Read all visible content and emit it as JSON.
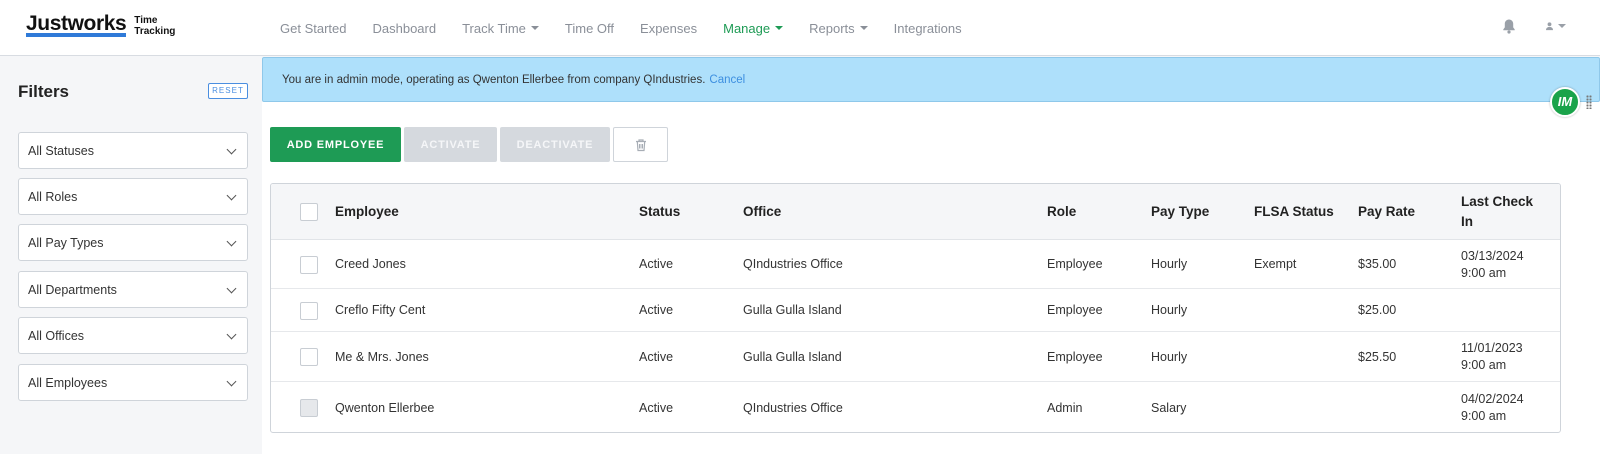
{
  "brand": {
    "name": "Justworks",
    "product_line1": "Time",
    "product_line2": "Tracking",
    "accent": "#2f7ad8"
  },
  "nav": [
    {
      "label": "Get Started",
      "dropdown": false,
      "active": false
    },
    {
      "label": "Dashboard",
      "dropdown": false,
      "active": false
    },
    {
      "label": "Track Time",
      "dropdown": true,
      "active": false
    },
    {
      "label": "Time Off",
      "dropdown": false,
      "active": false
    },
    {
      "label": "Expenses",
      "dropdown": false,
      "active": false
    },
    {
      "label": "Manage",
      "dropdown": true,
      "active": true
    },
    {
      "label": "Reports",
      "dropdown": true,
      "active": false
    },
    {
      "label": "Integrations",
      "dropdown": false,
      "active": false
    }
  ],
  "header_icons": [
    "bell-icon",
    "user-icon"
  ],
  "filters": {
    "title": "Filters",
    "reset_label": "RESET",
    "selects": [
      "All Statuses",
      "All Roles",
      "All Pay Types",
      "All Departments",
      "All Offices",
      "All Employees"
    ]
  },
  "banner": {
    "text": "You are in admin mode, operating as Qwenton Ellerbee from company QIndustries.",
    "cancel_label": "Cancel"
  },
  "badge": {
    "text": "IM"
  },
  "toolbar": {
    "add_label": "ADD EMPLOYEE",
    "activate_label": "ACTIVATE",
    "deactivate_label": "DEACTIVATE"
  },
  "table": {
    "columns": [
      "Employee",
      "Status",
      "Office",
      "Role",
      "Pay Type",
      "FLSA Status",
      "Pay Rate",
      "Last Check In"
    ],
    "rows": [
      {
        "employee": "Creed Jones",
        "status": "Active",
        "office": "QIndustries Office",
        "role": "Employee",
        "pay_type": "Hourly",
        "flsa": "Exempt",
        "pay_rate": "$35.00",
        "last_date": "03/13/2024",
        "last_time": "9:00 am"
      },
      {
        "employee": "Creflo Fifty Cent",
        "status": "Active",
        "office": "Gulla Gulla Island",
        "role": "Employee",
        "pay_type": "Hourly",
        "flsa": "",
        "pay_rate": "$25.00",
        "last_date": "",
        "last_time": ""
      },
      {
        "employee": "Me & Mrs. Jones",
        "status": "Active",
        "office": "Gulla Gulla Island",
        "role": "Employee",
        "pay_type": "Hourly",
        "flsa": "",
        "pay_rate": "$25.50",
        "last_date": "11/01/2023",
        "last_time": "9:00 am"
      },
      {
        "employee": "Qwenton Ellerbee",
        "status": "Active",
        "office": "QIndustries Office",
        "role": "Admin",
        "pay_type": "Salary",
        "flsa": "",
        "pay_rate": "",
        "last_date": "04/02/2024",
        "last_time": "9:00 am"
      }
    ]
  },
  "colors": {
    "primary_green": "#1e9b55",
    "banner_blue": "#aee0fb",
    "link_blue": "#3d8fe0"
  }
}
